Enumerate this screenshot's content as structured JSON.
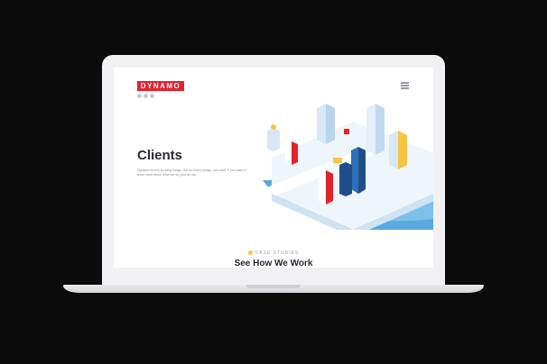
{
  "header": {
    "logo_text": "DYNAMO",
    "menu_icon": "hamburger-menu-icon"
  },
  "hero": {
    "title": "Clients",
    "description": "Dynamo excels at doing things. We do many things, cool stuff. If you want to learn more about what we do, just do too.",
    "illustration": "isometric-city-illustration"
  },
  "section": {
    "label": "CASE STUDIES",
    "title": "See How We Work"
  },
  "colors": {
    "brand": "#e3222c",
    "accent": "#f5c542",
    "heading": "#2a2a33",
    "city_blue": "#5aa9e0"
  }
}
